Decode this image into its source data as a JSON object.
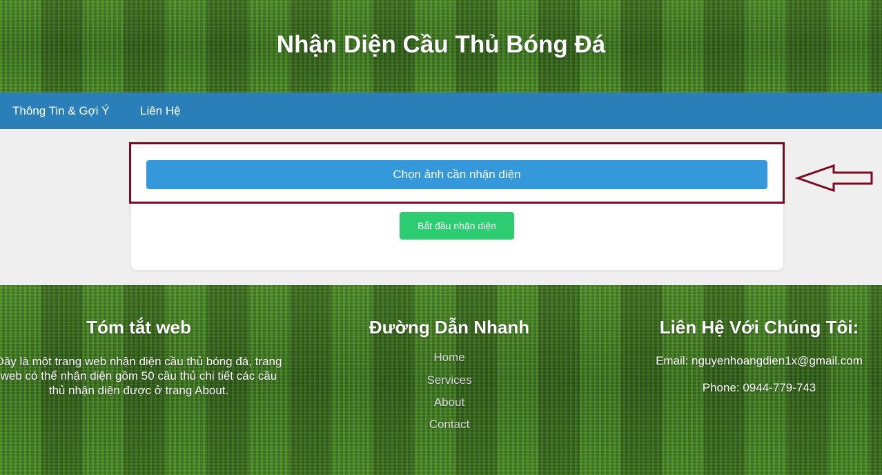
{
  "header": {
    "title": "Nhận Diện Cầu Thủ Bóng Đá"
  },
  "nav": {
    "items": [
      {
        "label": "Thông Tin & Gợi Ý"
      },
      {
        "label": "Liên Hệ"
      }
    ]
  },
  "upload": {
    "choose_label": "Chọn ảnh cần nhận diện",
    "start_label": "Bắt đầu nhận diện"
  },
  "annotation": {
    "highlight_color": "#7a0a22",
    "arrow": "left-arrow-icon"
  },
  "footer": {
    "summary": {
      "title": "Tóm tắt web",
      "text": "Đây là một trang web nhận diện cầu thủ bóng đá, trang web có thể nhận diện gồm 50 cầu thủ chi tiết các cầu thủ nhận diện được ở trang About."
    },
    "quick_links": {
      "title": "Đường Dẫn Nhanh",
      "items": [
        {
          "label": "Home"
        },
        {
          "label": "Services"
        },
        {
          "label": "About"
        },
        {
          "label": "Contact"
        }
      ]
    },
    "contact": {
      "title": "Liên Hệ Với Chúng Tôi:",
      "email": "Email: nguyenhoangdien1x@gmail.com",
      "phone": "Phone: 0944-779-743"
    }
  },
  "colors": {
    "nav_bg": "#2b7fb8",
    "choose_button": "#3498db",
    "start_button": "#2ecc71",
    "page_bg": "#efefef"
  }
}
